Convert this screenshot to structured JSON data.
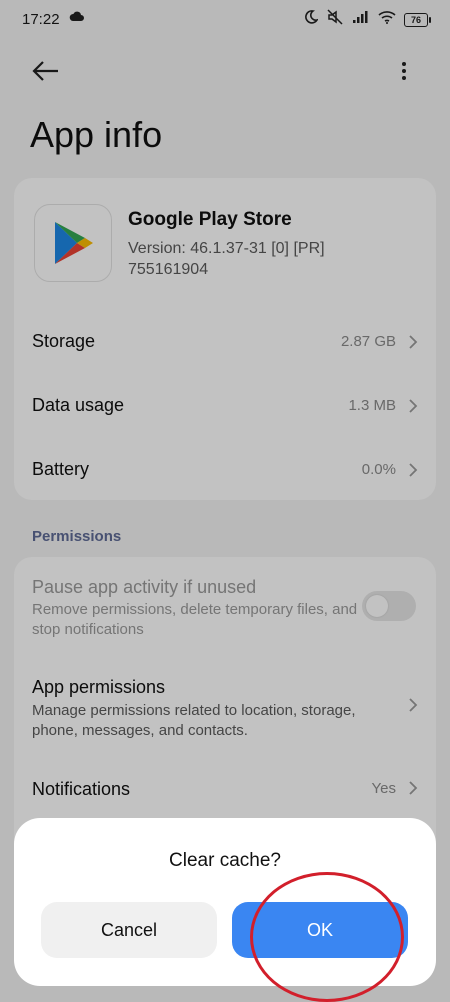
{
  "status_bar": {
    "time": "17:22",
    "battery": "76"
  },
  "header": {
    "title": "App info"
  },
  "app": {
    "name": "Google Play Store",
    "version": "Version: 46.1.37-31 [0] [PR]",
    "build": "755161904"
  },
  "app_rows": [
    {
      "label": "Storage",
      "value": "2.87 GB"
    },
    {
      "label": "Data usage",
      "value": "1.3 MB"
    },
    {
      "label": "Battery",
      "value": "0.0%"
    }
  ],
  "permissions": {
    "section_label": "Permissions",
    "pause": {
      "title": "Pause app activity if unused",
      "subtitle": "Remove permissions, delete temporary files, and stop notifications",
      "enabled": false
    },
    "app_permissions": {
      "title": "App permissions",
      "subtitle": "Manage permissions related to location, storage, phone, messages, and contacts."
    },
    "notifications": {
      "title": "Notifications",
      "value": "Yes"
    }
  },
  "dialog": {
    "title": "Clear cache?",
    "cancel_label": "Cancel",
    "ok_label": "OK"
  },
  "colors": {
    "accent": "#3a86f2",
    "annotation": "#d21f2b",
    "section": "#5f6b96"
  }
}
